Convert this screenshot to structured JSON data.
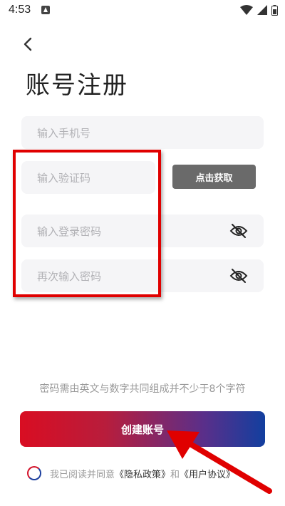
{
  "status_bar": {
    "time": "4:53"
  },
  "page": {
    "title": "账号注册"
  },
  "form": {
    "phone_placeholder": "输入手机号",
    "code_placeholder": "输入验证码",
    "get_code_label": "点击获取",
    "password_placeholder": "输入登录密码",
    "confirm_placeholder": "再次输入密码"
  },
  "hint": "密码需由英文与数字共同组成并不少于8个字符",
  "create_button": {
    "label": "创建账号"
  },
  "agreement": {
    "prefix": "我已阅读并同意",
    "privacy": "《隐私政策》",
    "and": "和",
    "user": "《用户协议》"
  },
  "colors": {
    "highlight": "#e00000",
    "gradient_start": "#d90d22",
    "gradient_end": "#123f9f"
  }
}
